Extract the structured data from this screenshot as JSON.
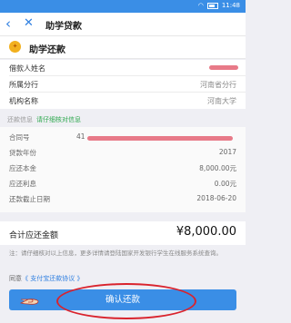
{
  "status_bar": {
    "time": "11:48"
  },
  "nav": {
    "back_icon": "‹",
    "close_icon": "✕",
    "title": "助学贷款"
  },
  "header": {
    "logo_text": "✦",
    "title": "助学还款"
  },
  "borrower_info": [
    {
      "label": "借款人姓名",
      "value": ""
    },
    {
      "label": "所属分行",
      "value": "河南省分行"
    },
    {
      "label": "机构名称",
      "value": "河南大学"
    }
  ],
  "repay_section": {
    "label": "还款信息",
    "hint": "请仔细核对信息"
  },
  "repay_info": [
    {
      "label": "合同号",
      "value": "41"
    },
    {
      "label": "贷款年份",
      "value": "2017"
    },
    {
      "label": "应还本金",
      "value": "8,000.00元"
    },
    {
      "label": "应还利息",
      "value": "0.00元"
    },
    {
      "label": "还款截止日期",
      "value": "2018-06-20"
    }
  ],
  "total": {
    "label": "合计应还金额",
    "value": "¥8,000.00"
  },
  "note": "注：请仔细核对以上信息，更多详情请登陆国家开发银行学生在线服务系统查询。",
  "agreement": {
    "prefix": "同意",
    "link": "《 支付宝还款协议 》"
  },
  "confirm_button": "确认还款",
  "colors": {
    "accent": "#3a8ee6",
    "highlight": "#d9232d",
    "hint_green": "#2fa84f"
  }
}
